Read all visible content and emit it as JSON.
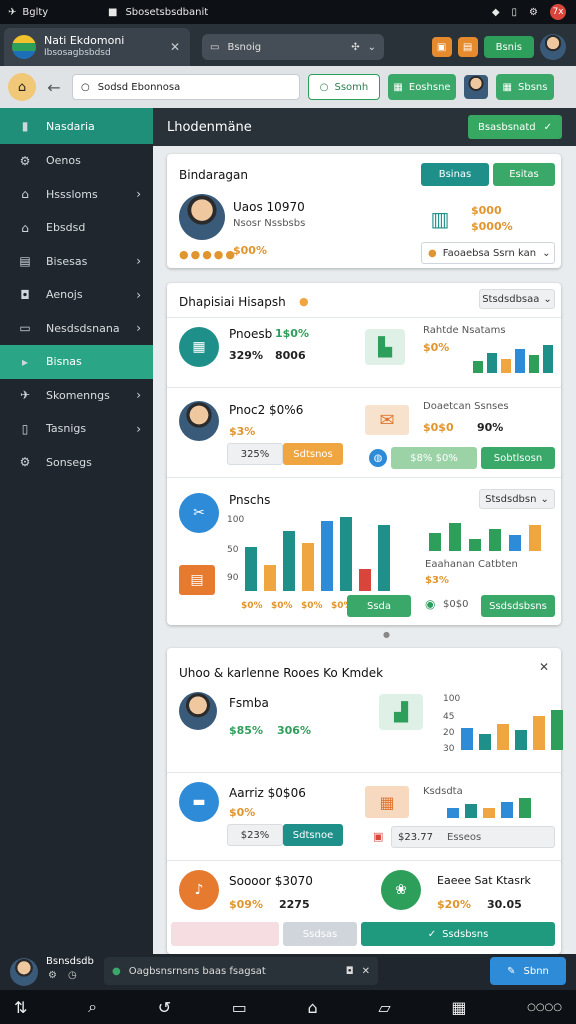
{
  "status": {
    "carrier": "Bglty",
    "notif": "Sbosetsbsdbanit",
    "badge": "7x"
  },
  "tab": {
    "title": "Nati Ekdomoni",
    "subtitle": "Ibsosagbsbdsd",
    "search": "Bsnoig"
  },
  "header": {
    "apply": "Bsnis"
  },
  "address": {
    "url": "Sodsd Ebonnosa",
    "search": "Ssomh",
    "btn1": "Eoshsne",
    "btn2": "Sbsns"
  },
  "sidebar": {
    "items": [
      {
        "label": "Nasdaria",
        "icon": "bookmark-icon"
      },
      {
        "label": "Oenos",
        "icon": "gear-icon"
      },
      {
        "label": "Hsssloms",
        "icon": "home-icon"
      },
      {
        "label": "Ebsdsd",
        "icon": "home-icon"
      },
      {
        "label": "Bisesas",
        "icon": "list-icon"
      },
      {
        "label": "Aenojs",
        "icon": "bag-icon"
      },
      {
        "label": "Nesdsdsnana",
        "icon": "window-icon"
      },
      {
        "label": "Bisnas",
        "icon": "location-icon"
      },
      {
        "label": "Skomenngs",
        "icon": "plane-icon"
      },
      {
        "label": "Tasnigs",
        "icon": "doc-icon"
      },
      {
        "label": "Sonsegs",
        "icon": "gear-icon"
      }
    ]
  },
  "main": {
    "title": "Lhodenmäne",
    "action": "Bsasbsnatd"
  },
  "card1": {
    "title": "Bindaragan",
    "btn_a": "Bsinas",
    "btn_b": "Esitas",
    "name": "Uaos 10970",
    "sub": "Nsosr Nssbsbs",
    "pct": "$00%",
    "val1": "$000",
    "val2": "$000%",
    "select": "Faoaebsa Ssrn kan"
  },
  "card2": {
    "title": "Dhapisiai Hisapsh",
    "filter": "Stsdsdbsaa",
    "row1": {
      "label": "Pnoesb",
      "v1": "1$0%",
      "v2": "329%",
      "v3": "8006",
      "right_title": "Rahtde Nsatams",
      "right_pct": "$0%"
    },
    "row2": {
      "label": "Pnoc2 $0%6",
      "pct": "$3%",
      "box": "325%",
      "btn": "Sdtsnos",
      "right_title": "Doaetcan Ssnses",
      "r1": "$0$0",
      "r2": "90%",
      "pill": "$8% $0%",
      "btn2": "Sobtlsosn"
    },
    "row3": {
      "label": "Pnschs",
      "y1": "100",
      "y2": "50",
      "y3": "90",
      "b1": "$0%",
      "b2": "$0%",
      "b3": "$0%",
      "b4": "$0%",
      "btn": "Ssda",
      "right_title": "Eaahanan Catbten",
      "right_pct": "$3%",
      "right_val": "$0$0",
      "btn2": "Ssdsdsbsns",
      "filter": "Stsdsdbsn"
    }
  },
  "card3": {
    "title": "Uhoo & karlenne Rooes Ko Kmdek",
    "row1": {
      "label": "Fsmba",
      "v1": "$85%",
      "v2": "306%",
      "y": [
        "100",
        "45",
        "20",
        "30"
      ]
    },
    "row2": {
      "label": "Aarriz $0$06",
      "pct": "$0%",
      "box": "$23%",
      "btn": "Sdtsnoe",
      "right_title": "Ksdsdta",
      "amount": "$23.77",
      "amount_tag": "Esseos"
    },
    "row3": {
      "label": "Soooor $3070",
      "v1": "$09%",
      "v2": "2275",
      "right_title": "Eaeee Sat Ktasrk",
      "rv1": "$20%",
      "rv2": "30.05",
      "btn1": "Ssdsas",
      "btn2": "Ssdsbsns"
    }
  },
  "footer": {
    "user": "Bsnsdsdb",
    "msg": "Oagbsnsrnsns baas fsagsat",
    "btn": "Sbnn"
  },
  "colors": {
    "teal": "#1f8f7a",
    "green": "#3aa868",
    "orange": "#f0a640",
    "blue": "#2e8bd8"
  }
}
